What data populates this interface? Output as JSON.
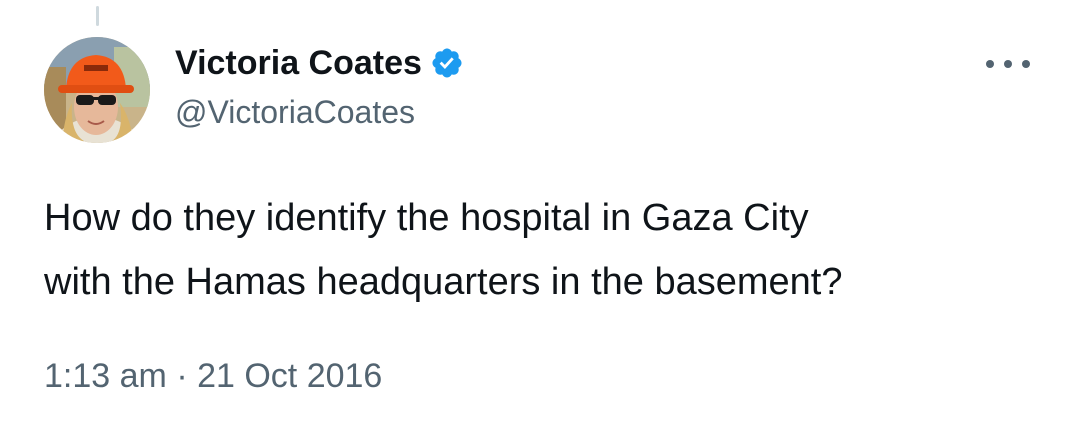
{
  "tweet": {
    "author": {
      "display_name": "Victoria Coates",
      "handle": "@VictoriaCoates",
      "verified": true,
      "avatar_icon": "profile-photo-hard-hat"
    },
    "more_icon": "more-horizontal-icon",
    "text_line_1": "How do they identify the hospital in Gaza City",
    "text_line_2": "with the Hamas headquarters in the basement?",
    "time": "1:13 am",
    "separator": "·",
    "date": "21 Oct 2016"
  },
  "colors": {
    "text_primary": "#0f1419",
    "text_secondary": "#536471",
    "verified_blue": "#1d9bf0",
    "thread_line": "#cfd9de"
  }
}
